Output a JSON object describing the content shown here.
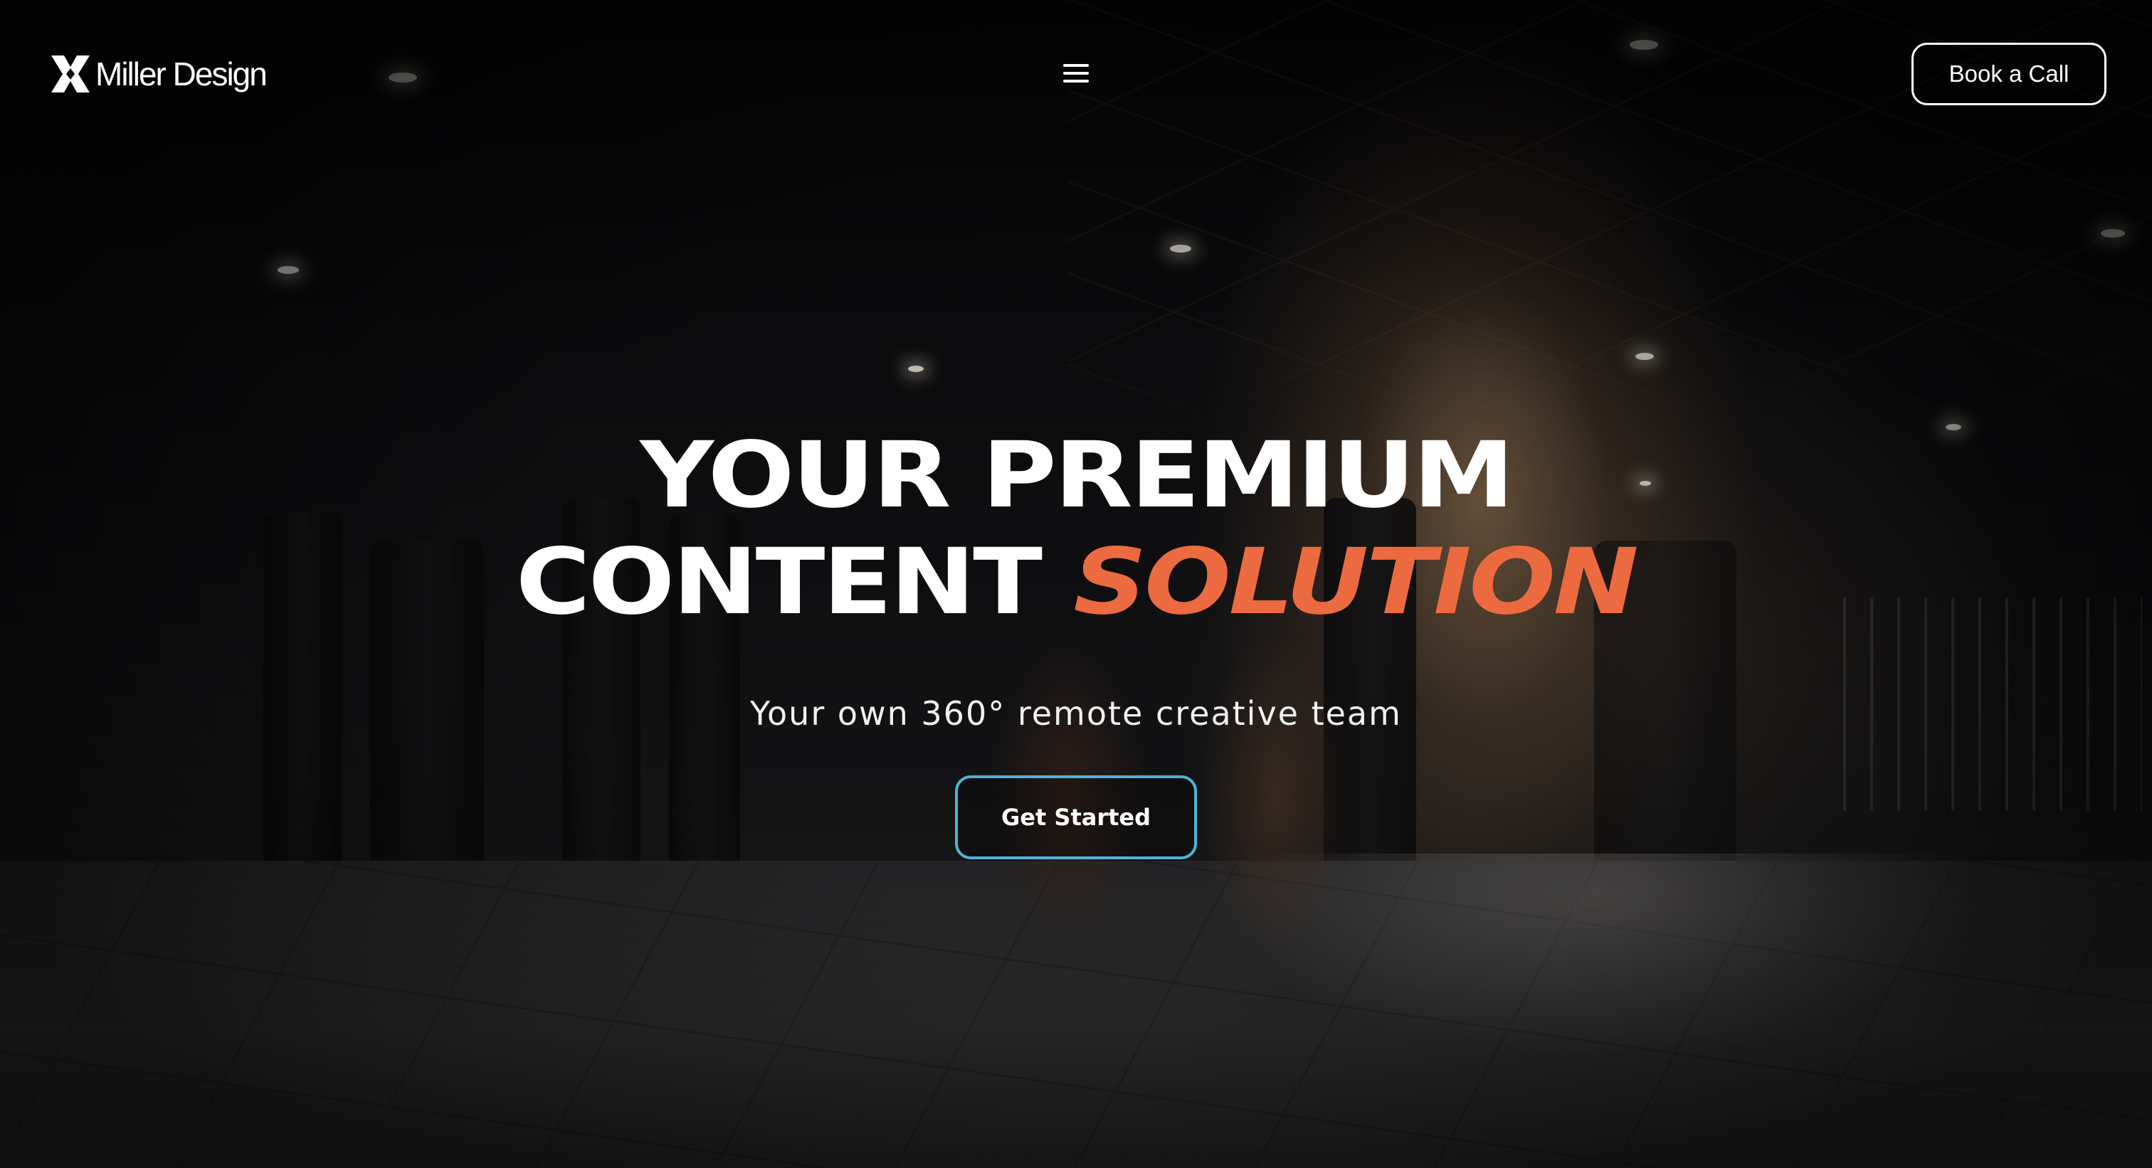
{
  "header": {
    "logo_text": "Miller Design",
    "book_call_label": "Book a Call"
  },
  "hero": {
    "title_line1": "YOUR PREMIUM",
    "title_line2_plain": "CONTENT",
    "title_line2_accent": "SOLUTION",
    "subtitle": "Your own 360° remote creative team",
    "cta_label": "Get Started"
  },
  "colors": {
    "accent": "#ec6a3f",
    "cta_border": "#4fb3d9",
    "text": "#ffffff"
  },
  "icons": {
    "logo": "miller-x-logo-icon",
    "menu": "hamburger-menu-icon"
  }
}
